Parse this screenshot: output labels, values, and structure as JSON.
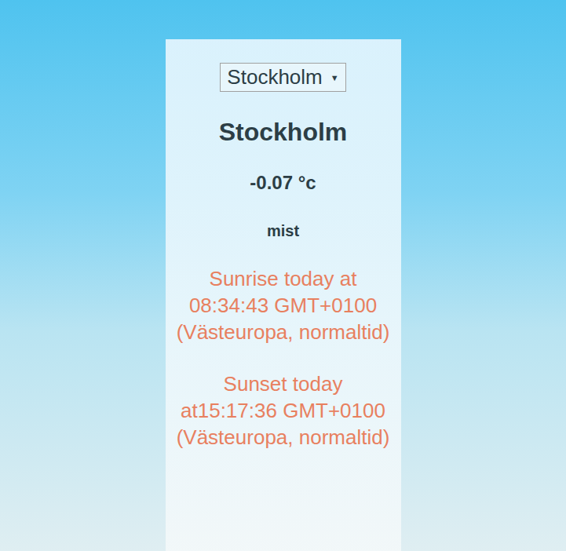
{
  "location_select": {
    "value": "Stockholm",
    "arrow": "▼"
  },
  "city": "Stockholm",
  "temperature": "-0.07 °c",
  "description": "mist",
  "sunrise": "Sunrise today at 08:34:43 GMT+0100 (Västeuropa, normaltid)",
  "sunset": "Sunset today at15:17:36 GMT+0100 (Västeuropa, normaltid)"
}
